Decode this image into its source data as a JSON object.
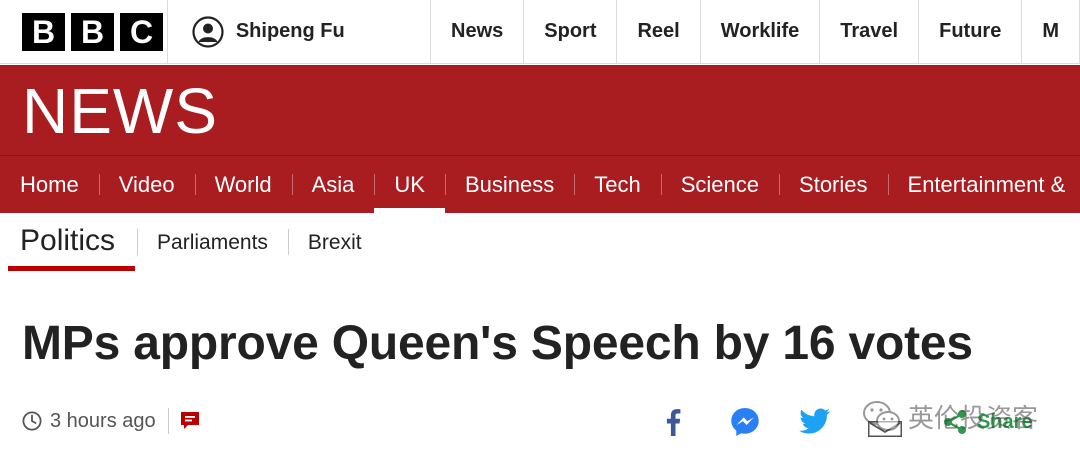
{
  "brand": {
    "letters": [
      "B",
      "B",
      "C"
    ]
  },
  "account": {
    "name": "Shipeng Fu"
  },
  "top_nav": [
    "News",
    "Sport",
    "Reel",
    "Worklife",
    "Travel",
    "Future",
    "M"
  ],
  "banner": {
    "wordmark": "NEWS",
    "color": "#a91d21"
  },
  "section_nav": {
    "items": [
      "Home",
      "Video",
      "World",
      "Asia",
      "UK",
      "Business",
      "Tech",
      "Science",
      "Stories",
      "Entertainment &"
    ],
    "active": "UK"
  },
  "sub_nav": {
    "title": "Politics",
    "items": [
      "Parliaments",
      "Brexit"
    ]
  },
  "article": {
    "headline": "MPs approve Queen's Speech by 16 votes",
    "timestamp": "3 hours ago"
  },
  "share": {
    "label": "Share",
    "icons": [
      "facebook-icon",
      "messenger-icon",
      "twitter-icon",
      "email-icon",
      "share-icon"
    ]
  },
  "watermark": {
    "text": "英伦投资客"
  }
}
